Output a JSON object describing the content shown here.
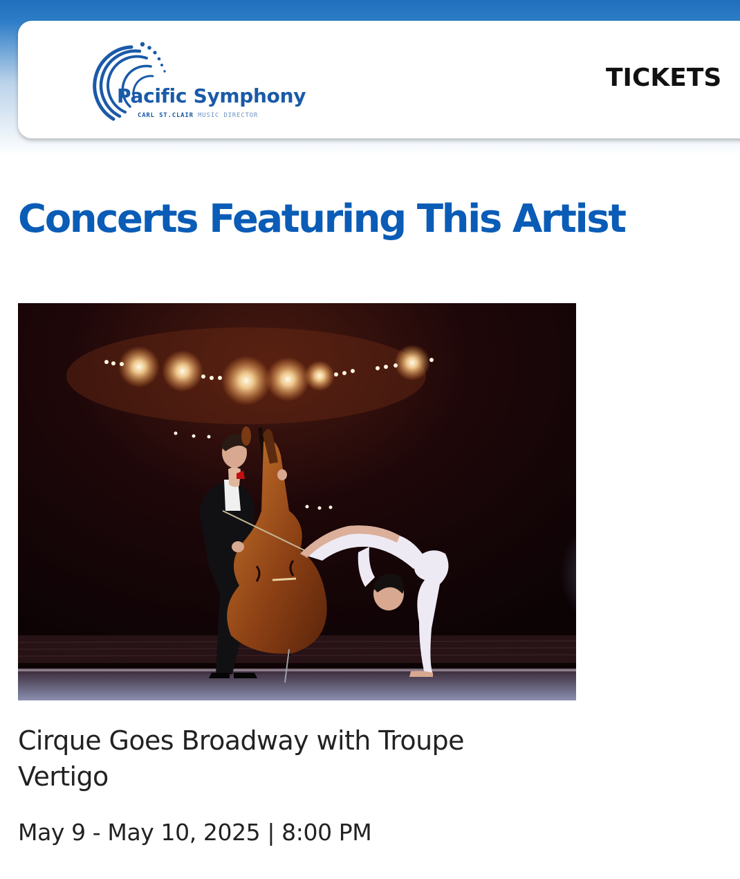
{
  "header": {
    "logo": {
      "name": "Pacific Symphony",
      "subtitle_strong": "CARL ST.CLAIR",
      "subtitle_light": "MUSIC DIRECTOR"
    },
    "nav": {
      "tickets_label": "TICKETS"
    }
  },
  "main": {
    "section_title": "Concerts Featuring This Artist",
    "concerts": [
      {
        "image_alt": "Double bass player and contortionist performing on stage under spotlights",
        "title": "Cirque Goes Broadway with Troupe Vertigo",
        "date": "May 9 - May 10, 2025 | 8:00 PM"
      }
    ]
  },
  "colors": {
    "brand_blue": "#0a5cb6",
    "logo_blue": "#1a5aa8",
    "header_band": "#1f6fbd",
    "text_dark": "#222222"
  }
}
